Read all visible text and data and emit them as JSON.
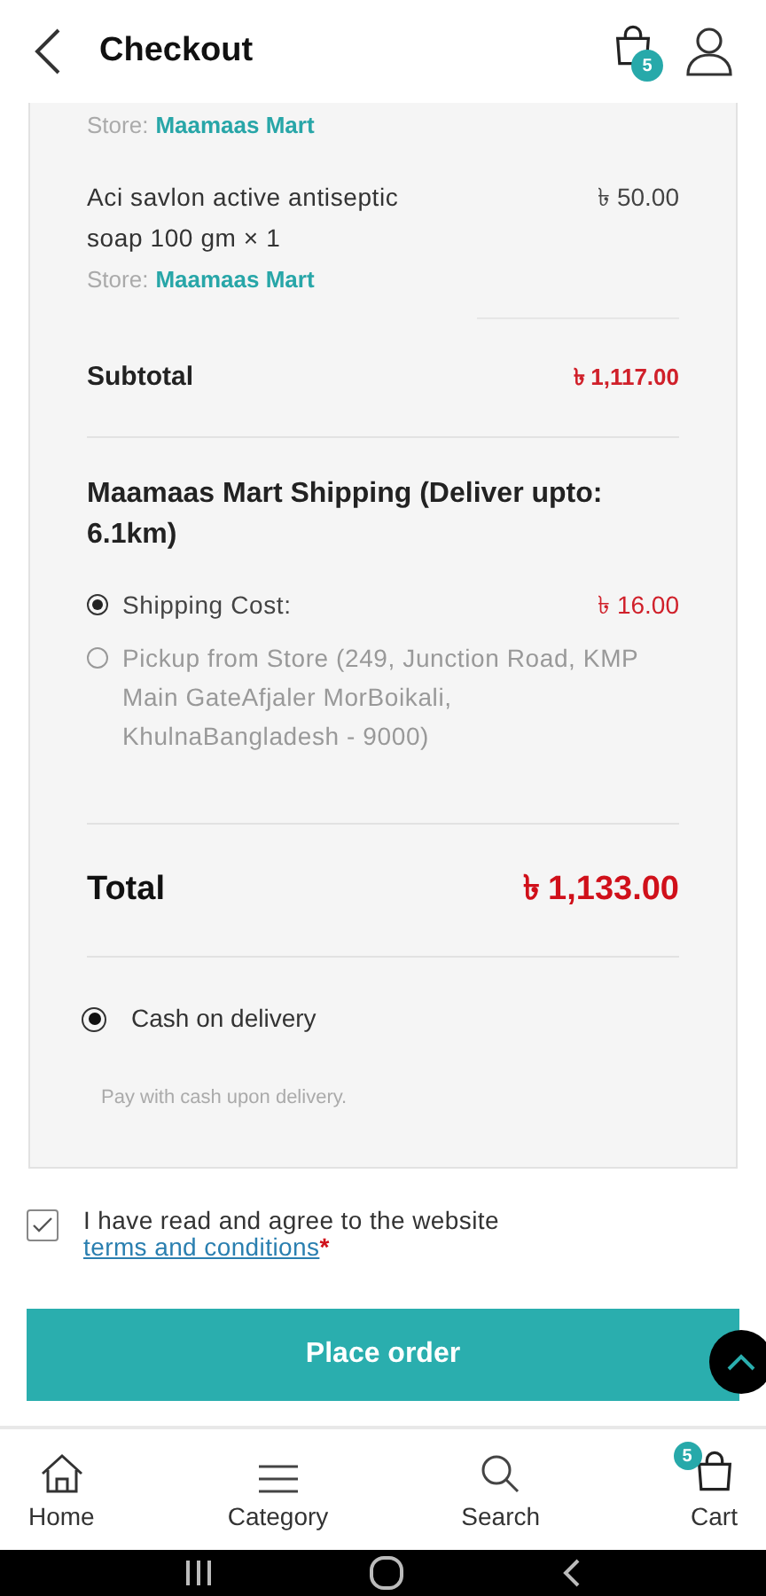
{
  "header": {
    "title": "Checkout",
    "cart_count": "5"
  },
  "items": [
    {
      "store_label": "Store:",
      "store_name": "Maamaas Mart",
      "kind": "store_only"
    },
    {
      "name": "Aci savlon active antiseptic soap 100 gm",
      "qty": "× 1",
      "price": "৳ 50.00",
      "store_label": "Store:",
      "store_name": "Maamaas Mart",
      "kind": "item"
    }
  ],
  "subtotal": {
    "label": "Subtotal",
    "value": "৳ 1,117.00"
  },
  "shipping": {
    "title": "Maamaas Mart Shipping (Deliver upto: 6.1km)",
    "options": [
      {
        "label": "Shipping Cost:",
        "price": "৳ 16.00",
        "selected": true
      },
      {
        "label": "Pickup from Store (249, Junction Road, KMP Main GateAfjaler MorBoikali, KhulnaBangladesh - 9000)",
        "selected": false
      }
    ]
  },
  "total": {
    "label": "Total",
    "value": "৳ 1,133.00"
  },
  "payment": {
    "options": [
      {
        "label": "Cash on delivery",
        "selected": true
      }
    ],
    "note": "Pay with cash upon delivery."
  },
  "terms": {
    "checked": true,
    "text": "I have read and agree to the website",
    "link": "terms and conditions",
    "required_mark": "*"
  },
  "place_order": "Place order",
  "bottom_nav": [
    {
      "label": "Home",
      "kind": "home"
    },
    {
      "label": "Category",
      "kind": "menu"
    },
    {
      "label": "Search",
      "kind": "search"
    },
    {
      "label": "Cart",
      "kind": "cart",
      "badge": "5"
    }
  ]
}
